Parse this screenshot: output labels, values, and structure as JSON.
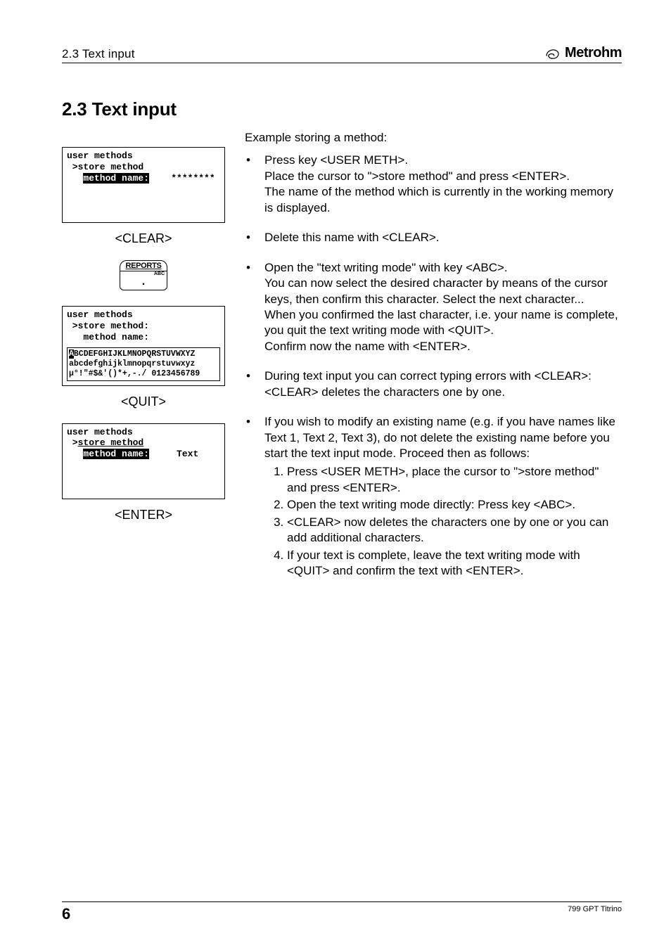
{
  "header": {
    "left": "2.3 Text input",
    "brand": "Metrohm"
  },
  "section_title": "2.3  Text input",
  "left_col": {
    "lcd1": {
      "line1": "user methods",
      "line2": " >store method",
      "line3_label": "method name:",
      "line3_value": "********"
    },
    "label1": "<CLEAR>",
    "reports_key": {
      "top": "REPORTS",
      "abc": "ABC",
      "dot": "."
    },
    "lcd2": {
      "line1": "user methods",
      "line2": " >store method:",
      "line3": "   method name:",
      "cs_hl": "A",
      "cs1_rest": "BCDEFGHIJKLMNOPQRSTUVWXYZ",
      "cs2": "abcdefghijklmnopqrstuvwxyz",
      "cs3": "µ°!\"#$&'()*+,-./ 0123456789"
    },
    "label2": "<QUIT>",
    "lcd3": {
      "line1": "user methods",
      "line2_prefix": " >",
      "line2_under": "store method",
      "line3_label": "method name:",
      "line3_value": "Text"
    },
    "label3": "<ENTER>"
  },
  "right_col": {
    "intro": "Example storing a method:",
    "b1_l1": "Press key <USER METH>.",
    "b1_l2": "Place the cursor to \">store method\" and press <ENTER>.",
    "b1_l3": "The name of the method which is currently in the working memory is displayed.",
    "b2": "Delete this name with <CLEAR>.",
    "b3_l1": "Open the \"text writing mode\" with key <ABC>.",
    "b3_l2": "You can now select the desired character by means of the cursor keys, then confirm this character. Select the next character...",
    "b3_l3": "When you confirmed the last character, i.e. your name is complete, you quit the text writing mode with <QUIT>.",
    "b3_l4": "Confirm now the name with <ENTER>.",
    "b4_l1": "During text input you can correct typing errors with <CLEAR>:",
    "b4_l2": "<CLEAR> deletes the characters one by one.",
    "b5_intro": "If you wish to modify an existing name (e.g. if you have names like Text 1, Text 2, Text 3), do not delete the existing name before you start the text input mode. Proceed then as follows:",
    "b5_steps": [
      "Press <USER METH>, place the cursor to \">store method\" and press <ENTER>.",
      "Open the text writing mode directly: Press key <ABC>.",
      "<CLEAR> now deletes the characters one by one or you can add additional characters.",
      "If your text is complete, leave the text writing mode with <QUIT> and confirm the text with <ENTER>."
    ]
  },
  "footer": {
    "page": "6",
    "model": "799 GPT Titrino"
  }
}
